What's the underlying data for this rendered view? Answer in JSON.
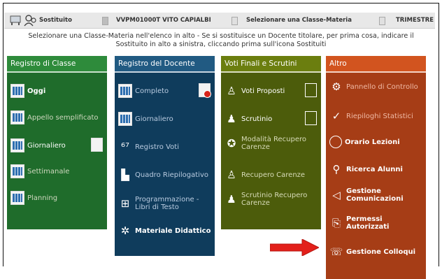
{
  "topbar": {
    "user_label": "Sostituito",
    "teacher_label": "VVPM01000T VITO CAPIALBI",
    "select_label": "Selezionare una Classe-Materia",
    "period_label": "TRIMESTRE"
  },
  "instructions": "Selezionare una Classe-Materia nell'elenco in alto - Se si sostituisce un Docente titolare, per prima cosa, indicare il Sostituito in alto a sinistra, cliccando prima sull'icona Sostituiti",
  "columns": {
    "registro_classe": {
      "title": "Registro di Classe",
      "items": [
        "Oggi",
        "Appello semplificato",
        "Giornaliero",
        "Settimanale",
        "Planning"
      ]
    },
    "registro_docente": {
      "title": "Registro del Docente",
      "items": [
        "Completo",
        "Giornaliero",
        "Registro Voti",
        "Quadro Riepilogativo",
        "Programmazione - Libri di Testo",
        "Materiale Didattico"
      ]
    },
    "voti_finali": {
      "title": "Voti Finali e Scrutini",
      "items": [
        "Voti Proposti",
        "Scrutinio",
        "Modalità Recupero Carenze",
        "Recupero Carenze",
        "Scrutinio Recupero Carenze"
      ]
    },
    "altro": {
      "title": "Altro",
      "items": [
        "Pannello di Controllo",
        "Riepiloghi Statistici",
        "Orario Lezioni",
        "Ricerca Alunni",
        "Gestione Comunicazioni",
        "Permessi Autorizzati",
        "Gestione Colloqui"
      ]
    }
  },
  "colors": {
    "registro_classe": "#2e8b3b",
    "registro_docente": "#215a82",
    "voti_finali": "#6b7e0f",
    "altro": "#d2541f",
    "arrow": "#e3201b"
  }
}
